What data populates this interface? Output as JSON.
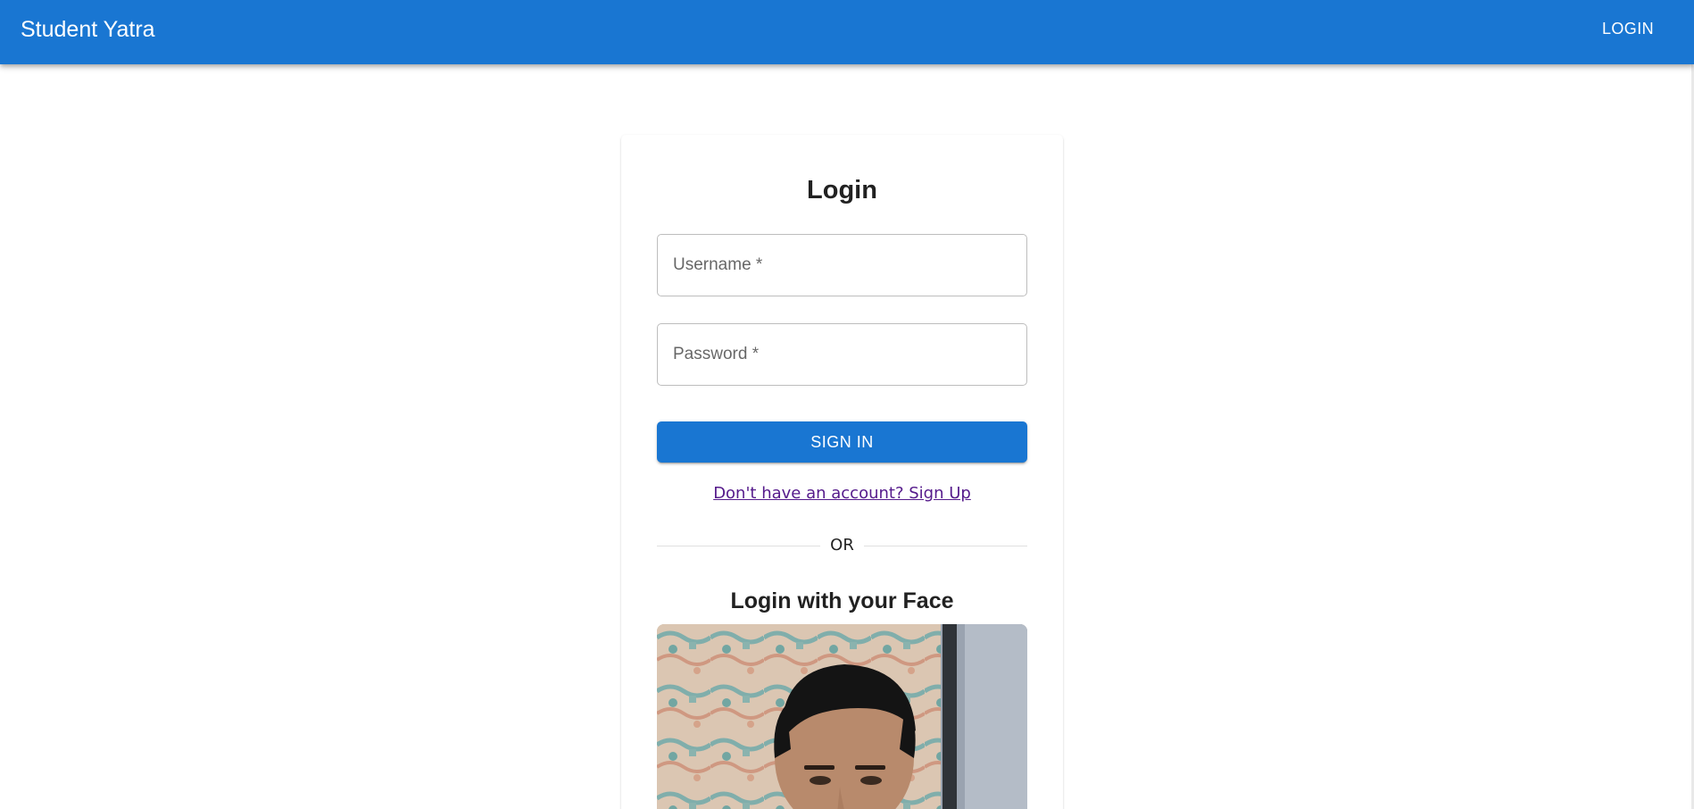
{
  "app": {
    "title": "Student Yatra",
    "nav_login": "LOGIN"
  },
  "login": {
    "title": "Login",
    "username_placeholder": "Username *",
    "password_placeholder": "Password *",
    "signin_label": "SIGN IN",
    "signup_link": "Don't have an account? Sign Up",
    "divider_text": "OR",
    "face_title": "Login with your Face"
  },
  "colors": {
    "primary": "#1976d2",
    "link_visited": "#551a8b"
  }
}
